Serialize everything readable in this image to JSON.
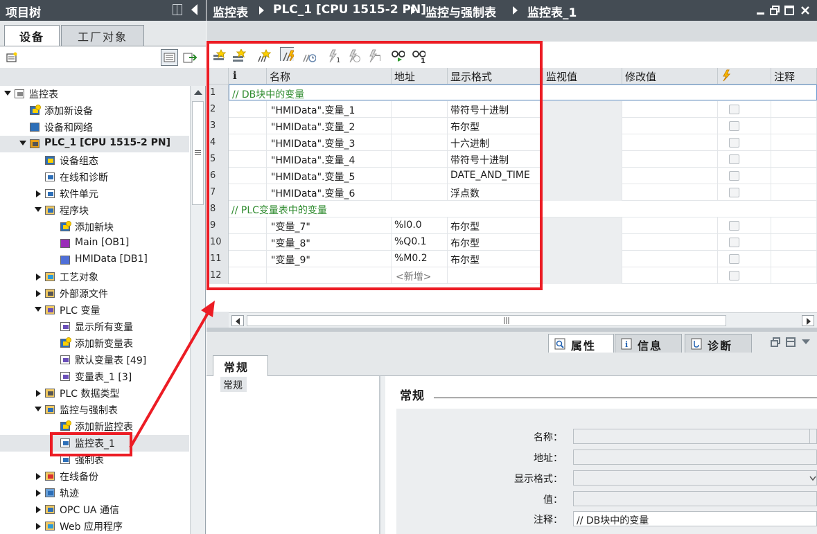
{
  "left_panel": {
    "title": "项目树",
    "tabs": {
      "devices": "设备",
      "tech_objects": "工厂对象"
    },
    "tree": [
      {
        "label": "监控表",
        "level": 0,
        "toggle": "open",
        "icon": "sheet-icon"
      },
      {
        "label": "添加新设备",
        "level": 1,
        "toggle": "",
        "icon": "add-device-icon"
      },
      {
        "label": "设备和网络",
        "level": 1,
        "toggle": "",
        "icon": "network-icon"
      },
      {
        "label": "PLC_1 [CPU 1515-2 PN]",
        "level": 1,
        "toggle": "open",
        "icon": "plc-icon"
      },
      {
        "label": "设备组态",
        "level": 2,
        "toggle": "",
        "icon": "device-config-icon"
      },
      {
        "label": "在线和诊断",
        "level": 2,
        "toggle": "",
        "icon": "online-diag-icon"
      },
      {
        "label": "软件单元",
        "level": 2,
        "toggle": "closed",
        "icon": "software-unit-icon"
      },
      {
        "label": "程序块",
        "level": 2,
        "toggle": "open",
        "icon": "folder-icon"
      },
      {
        "label": "添加新块",
        "level": 3,
        "toggle": "",
        "icon": "add-block-icon"
      },
      {
        "label": "Main [OB1]",
        "level": 3,
        "toggle": "",
        "icon": "ob-icon"
      },
      {
        "label": "HMIData [DB1]",
        "level": 3,
        "toggle": "",
        "icon": "db-icon"
      },
      {
        "label": "工艺对象",
        "level": 2,
        "toggle": "closed",
        "icon": "tech-object-icon"
      },
      {
        "label": "外部源文件",
        "level": 2,
        "toggle": "closed",
        "icon": "external-source-icon"
      },
      {
        "label": "PLC 变量",
        "level": 2,
        "toggle": "open",
        "icon": "plc-tags-icon"
      },
      {
        "label": "显示所有变量",
        "level": 3,
        "toggle": "",
        "icon": "show-tags-icon"
      },
      {
        "label": "添加新变量表",
        "level": 3,
        "toggle": "",
        "icon": "add-tag-table-icon"
      },
      {
        "label": "默认变量表 [49]",
        "level": 3,
        "toggle": "",
        "icon": "tag-table-icon"
      },
      {
        "label": "变量表_1 [3]",
        "level": 3,
        "toggle": "",
        "icon": "tag-table-icon"
      },
      {
        "label": "PLC 数据类型",
        "level": 2,
        "toggle": "closed",
        "icon": "data-type-icon"
      },
      {
        "label": "监控与强制表",
        "level": 2,
        "toggle": "open",
        "icon": "watch-folder-icon"
      },
      {
        "label": "添加新监控表",
        "level": 3,
        "toggle": "",
        "icon": "add-watch-table-icon"
      },
      {
        "label": "监控表_1",
        "level": 3,
        "toggle": "",
        "icon": "watch-table-icon",
        "selected": true
      },
      {
        "label": "强制表",
        "level": 3,
        "toggle": "",
        "icon": "force-table-icon"
      },
      {
        "label": "在线备份",
        "level": 2,
        "toggle": "closed",
        "icon": "online-backup-icon"
      },
      {
        "label": "轨迹",
        "level": 2,
        "toggle": "closed",
        "icon": "trace-icon"
      },
      {
        "label": "OPC UA 通信",
        "level": 2,
        "toggle": "closed",
        "icon": "opcua-icon"
      },
      {
        "label": "Web 应用程序",
        "level": 2,
        "toggle": "closed",
        "icon": "web-app-icon"
      }
    ]
  },
  "main": {
    "breadcrumb": [
      "监控表",
      "PLC_1 [CPU 1515-2 PN]",
      "监控与强制表",
      "监控表_1"
    ],
    "columns": {
      "info": "i",
      "name": "名称",
      "address": "地址",
      "format": "显示格式",
      "monitor": "监视值",
      "modify": "修改值",
      "comment": "注释"
    },
    "rows": [
      {
        "n": "1",
        "comment": "// DB块中的变量",
        "name": "",
        "address": "",
        "format": "",
        "checkbox": false
      },
      {
        "n": "2",
        "comment": "",
        "name": "\"HMIData\".变量_1",
        "address": "",
        "format": "带符号十进制",
        "checkbox": true
      },
      {
        "n": "3",
        "comment": "",
        "name": "\"HMIData\".变量_2",
        "address": "",
        "format": "布尔型",
        "checkbox": true
      },
      {
        "n": "4",
        "comment": "",
        "name": "\"HMIData\".变量_3",
        "address": "",
        "format": "十六进制",
        "checkbox": true
      },
      {
        "n": "5",
        "comment": "",
        "name": "\"HMIData\".变量_4",
        "address": "",
        "format": "带符号十进制",
        "checkbox": true
      },
      {
        "n": "6",
        "comment": "",
        "name": "\"HMIData\".变量_5",
        "address": "",
        "format": "DATE_AND_TIME",
        "checkbox": true
      },
      {
        "n": "7",
        "comment": "",
        "name": "\"HMIData\".变量_6",
        "address": "",
        "format": "浮点数",
        "checkbox": true
      },
      {
        "n": "8",
        "comment": "// PLC变量表中的变量",
        "name": "",
        "address": "",
        "format": "",
        "checkbox": false
      },
      {
        "n": "9",
        "comment": "",
        "name": "\"变量_7\"",
        "address": "%I0.0",
        "format": "布尔型",
        "checkbox": true
      },
      {
        "n": "10",
        "comment": "",
        "name": "\"变量_8\"",
        "address": "%Q0.1",
        "format": "布尔型",
        "checkbox": true
      },
      {
        "n": "11",
        "comment": "",
        "name": "\"变量_9\"",
        "address": "%M0.2",
        "format": "布尔型",
        "checkbox": true
      },
      {
        "n": "12",
        "comment": "",
        "name": "",
        "address": "<新增>",
        "format": "",
        "checkbox": true
      }
    ]
  },
  "properties": {
    "tabs": {
      "properties": "属性",
      "info": "信息",
      "diagnostics": "诊断"
    },
    "general_tab": "常规",
    "nav_item": "常规",
    "section_title": "常规",
    "fields": {
      "name_label": "名称：",
      "address_label": "地址：",
      "format_label": "显示格式：",
      "value_label": "值：",
      "comment_label": "注释：",
      "comment_value": "// DB块中的变量"
    }
  },
  "colors": {
    "title_bar": "#444c54",
    "annotation_red": "#ec1c24",
    "comment_green": "#2e8b2e"
  }
}
